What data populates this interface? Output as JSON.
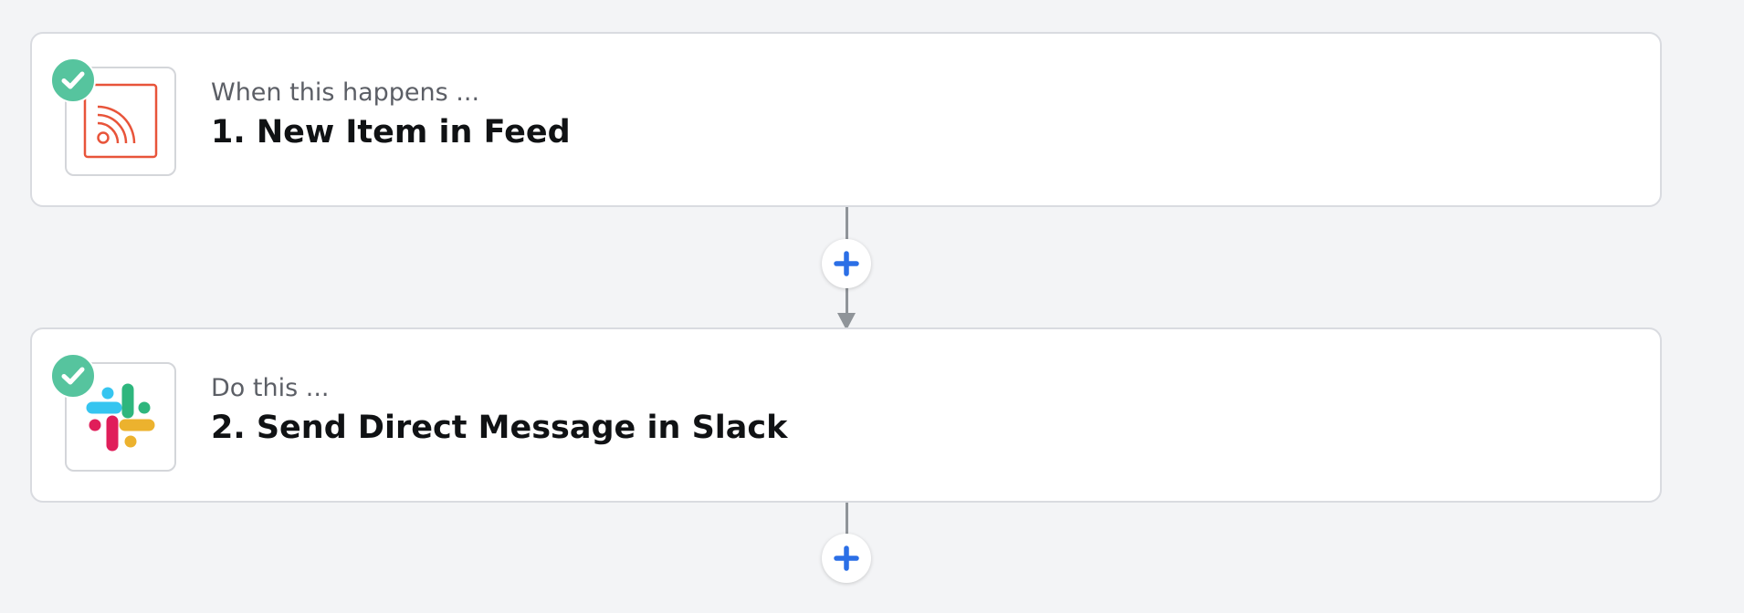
{
  "steps": [
    {
      "label": "When this happens ...",
      "title": "1. New Item in Feed",
      "app_icon": "rss-feed-icon",
      "status": "complete",
      "accent_color": "#e8543a"
    },
    {
      "label": "Do this ...",
      "title": "2. Send Direct Message in Slack",
      "app_icon": "slack-icon",
      "status": "complete",
      "slack_colors": [
        "#36c5f0",
        "#2eb67d",
        "#ecb22e",
        "#e01e5a"
      ]
    }
  ],
  "connectors": {
    "add_icon": "plus-icon",
    "add_color": "#2b6fe6",
    "badge_icon": "checkmark-icon",
    "badge_color": "#56c49e"
  }
}
